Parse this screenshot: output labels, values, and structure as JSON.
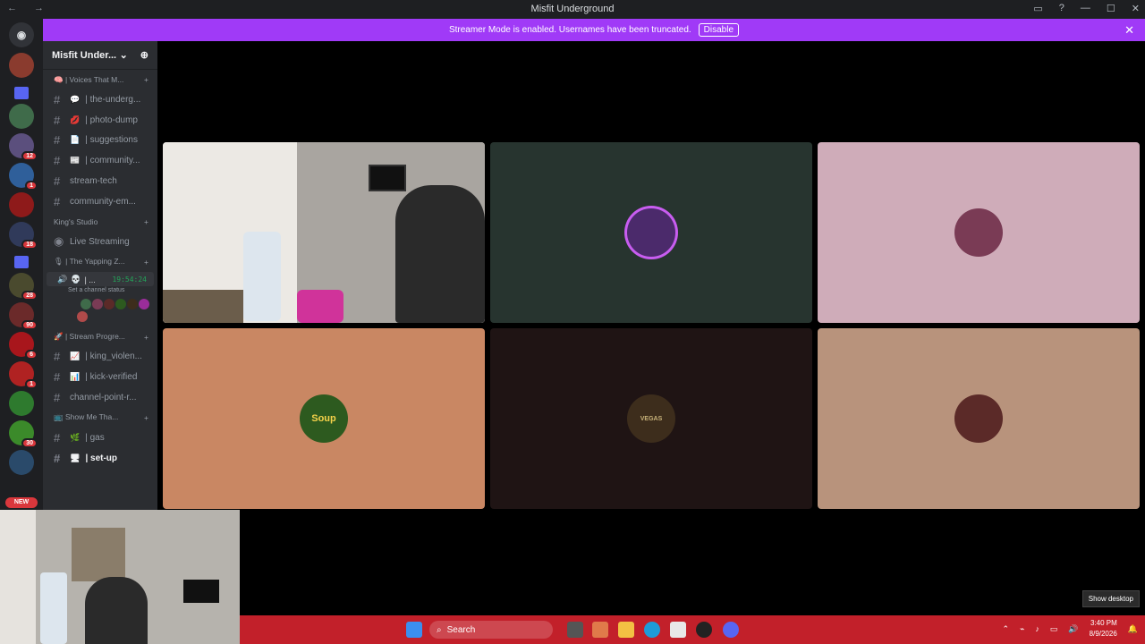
{
  "window": {
    "title": "Misfit Underground",
    "nav": "← →",
    "controls": [
      "▭",
      "?",
      "—",
      "☐",
      "✕"
    ]
  },
  "banner": {
    "text": "Streamer Mode is enabled. Usernames have been truncated.",
    "button": "Disable",
    "close": "✕"
  },
  "guilds": {
    "badges": [
      "12",
      "1",
      "18",
      "28",
      "90",
      "6",
      "1",
      "30"
    ],
    "new_label": "NEW"
  },
  "server": {
    "name": "Misfit Under...",
    "chevron": "⌄",
    "invite_icon": "person-add-icon"
  },
  "sidebar": {
    "categories": [
      {
        "label": "| Voices That M...",
        "emoji": "🧠"
      },
      {
        "label": "King's Studio",
        "emoji": ""
      },
      {
        "label": "| The Yapping Z...",
        "emoji": "🎙"
      },
      {
        "label": "| Stream Progre...",
        "emoji": "🚀"
      },
      {
        "label": "Show Me Tha...",
        "emoji": "📺"
      }
    ],
    "channels_a": [
      {
        "emoji": "💬",
        "label": "| the-underg..."
      },
      {
        "emoji": "💋",
        "label": "| photo-dump"
      },
      {
        "emoji": "📄",
        "label": "| suggestions"
      },
      {
        "emoji": "📰",
        "label": "| community..."
      },
      {
        "emoji": "",
        "label": "stream-tech"
      },
      {
        "emoji": "",
        "label": "community-em..."
      }
    ],
    "live": "Live Streaming",
    "voice_user": {
      "name": "| ...",
      "time": "19:54:24",
      "status": "Set a channel status"
    },
    "channels_b": [
      {
        "emoji": "📈",
        "label": "| king_violen..."
      },
      {
        "emoji": "📊",
        "label": "| kick-verified"
      },
      {
        "emoji": "",
        "label": "channel-point-r..."
      }
    ],
    "channels_c": [
      {
        "emoji": "🌿",
        "label": "| gas"
      },
      {
        "emoji": "🖥",
        "label": "| set-up"
      }
    ]
  },
  "tiles": [
    {
      "type": "camera",
      "bg": "#cfcbc5"
    },
    {
      "type": "avatar",
      "bg": "#27342f",
      "pfp_bg": "#4b2a6b",
      "label": ""
    },
    {
      "type": "avatar",
      "bg": "#cfacb9",
      "pfp_bg": "#7a3b55",
      "label": ""
    },
    {
      "type": "avatar",
      "bg": "#c98763",
      "pfp_bg": "#2d5a1f",
      "label": "Soup"
    },
    {
      "type": "avatar",
      "bg": "#1f1414",
      "pfp_bg": "#3d2d1c",
      "label": "VEGAS"
    },
    {
      "type": "avatar",
      "bg": "#b8937c",
      "pfp_bg": "#5b2a28",
      "label": ""
    }
  ],
  "taskbar": {
    "search": "Search",
    "time": "3:40 PM",
    "date": "8/9/2026",
    "show_desktop": "Show desktop"
  }
}
